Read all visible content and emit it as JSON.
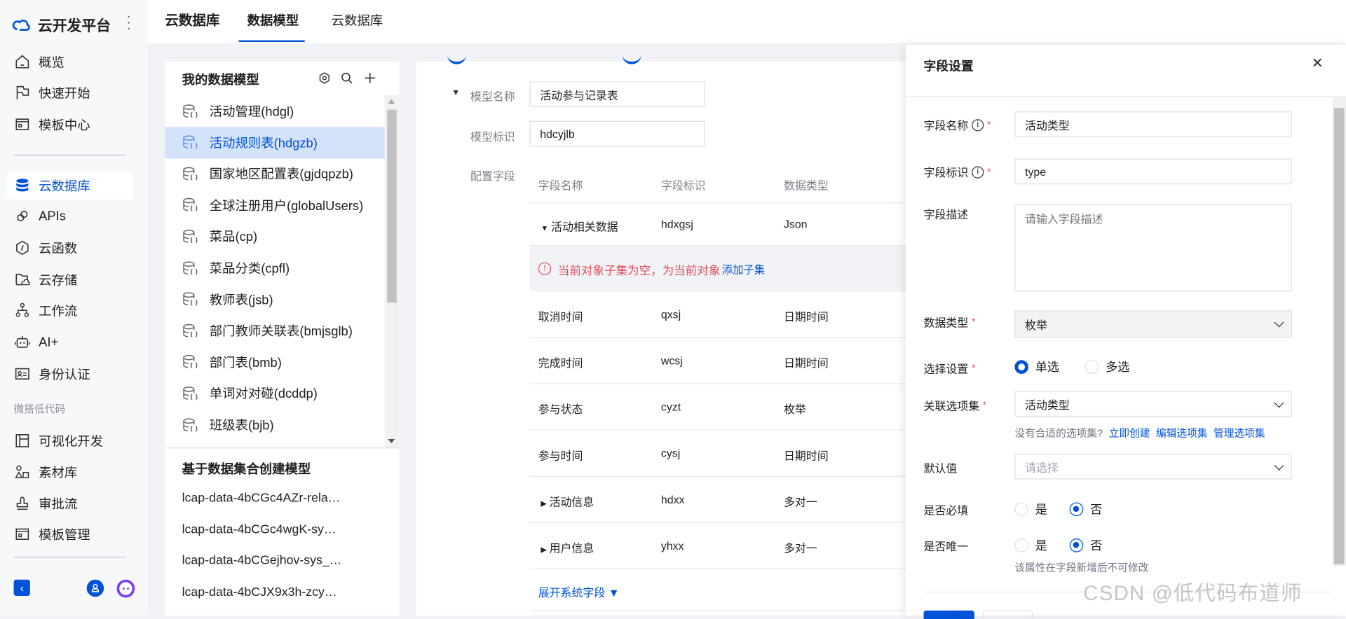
{
  "app": {
    "title": "云开发平台"
  },
  "sidebar": {
    "items": [
      {
        "label": "概览",
        "icon": "home-icon"
      },
      {
        "label": "快速开始",
        "icon": "flag-icon"
      },
      {
        "label": "模板中心",
        "icon": "template-icon"
      },
      {
        "label": "云数据库",
        "icon": "database-icon",
        "active": true
      },
      {
        "label": "APIs",
        "icon": "link-icon"
      },
      {
        "label": "云函数",
        "icon": "function-icon"
      },
      {
        "label": "云存储",
        "icon": "folder-cloud-icon"
      },
      {
        "label": "工作流",
        "icon": "workflow-icon"
      },
      {
        "label": "AI+",
        "icon": "robot-icon"
      },
      {
        "label": "身份认证",
        "icon": "id-card-icon"
      }
    ],
    "section_label": "微搭低代码",
    "lowcode_items": [
      {
        "label": "可视化开发",
        "icon": "layout-icon"
      },
      {
        "label": "素材库",
        "icon": "shapes-icon"
      },
      {
        "label": "审批流",
        "icon": "stamp-icon"
      },
      {
        "label": "模板管理",
        "icon": "template-icon"
      }
    ]
  },
  "header": {
    "section": "云数据库",
    "tabs": [
      {
        "label": "数据模型",
        "active": true
      },
      {
        "label": "云数据库",
        "active": false
      }
    ]
  },
  "models": {
    "title": "我的数据模型",
    "items": [
      "活动管理(hdgl)",
      "活动规则表(hdgzb)",
      "国家地区配置表(gjdqpzb)",
      "全球注册用户(globalUsers)",
      "菜品(cp)",
      "菜品分类(cpfl)",
      "教师表(jsb)",
      "部门教师关联表(bmjsglb)",
      "部门表(bmb)",
      "单词对对碰(dcddp)",
      "班级表(bjb)"
    ],
    "selected_index": 1,
    "dataset_title": "基于数据集合创建模型",
    "datasets": [
      "lcap-data-4bCGc4AZr-rela…",
      "lcap-data-4bCGc4wgK-sy…",
      "lcap-data-4bCGejhov-sys_…",
      "lcap-data-4bCJX9x3h-zcy…"
    ]
  },
  "form": {
    "model_name_label": "模型名称",
    "model_name": "活动参与记录表",
    "model_id_label": "模型标识",
    "model_id": "hdcyjlb",
    "fields_label": "配置字段",
    "columns": [
      "字段名称",
      "字段标识",
      "数据类型"
    ],
    "rows": [
      {
        "name": "活动相关数据",
        "id": "hdxgsj",
        "type": "Json",
        "toggle": "expanded"
      },
      {
        "name": "取消时间",
        "id": "qxsj",
        "type": "日期时间"
      },
      {
        "name": "完成时间",
        "id": "wcsj",
        "type": "日期时间"
      },
      {
        "name": "参与状态",
        "id": "cyzt",
        "type": "枚举"
      },
      {
        "name": "参与时间",
        "id": "cysj",
        "type": "日期时间"
      },
      {
        "name": "活动信息",
        "id": "hdxx",
        "type": "多对一",
        "toggle": "collapsed"
      },
      {
        "name": "用户信息",
        "id": "yhxx",
        "type": "多对一",
        "toggle": "collapsed"
      }
    ],
    "empty_notice": "当前对象子集为空，为当前对象",
    "add_child": "添加子集",
    "expand_system": "展开系统字段 ▼"
  },
  "drawer": {
    "title": "字段设置",
    "field_name_label": "字段名称",
    "field_name": "活动类型",
    "field_id_label": "字段标识",
    "field_id": "type",
    "desc_label": "字段描述",
    "desc_placeholder": "请输入字段描述",
    "type_label": "数据类型",
    "type_value": "枚举",
    "select_label": "选择设置",
    "single": "单选",
    "multi": "多选",
    "optionset_label": "关联选项集",
    "optionset_value": "活动类型",
    "no_optionset": "没有合适的选项集?",
    "create": "立即创建",
    "edit": "编辑选项集",
    "manage": "管理选项集",
    "default_label": "默认值",
    "default_placeholder": "请选择",
    "required_label": "是否必填",
    "unique_label": "是否唯一",
    "yes": "是",
    "no": "否",
    "unique_hint": "该属性在字段新增后不可修改"
  },
  "watermark": "CSDN @低代码布道师",
  "colors": {
    "primary": "#0052d9",
    "error": "#e34d59",
    "selected_bg": "#d4e3fc"
  }
}
